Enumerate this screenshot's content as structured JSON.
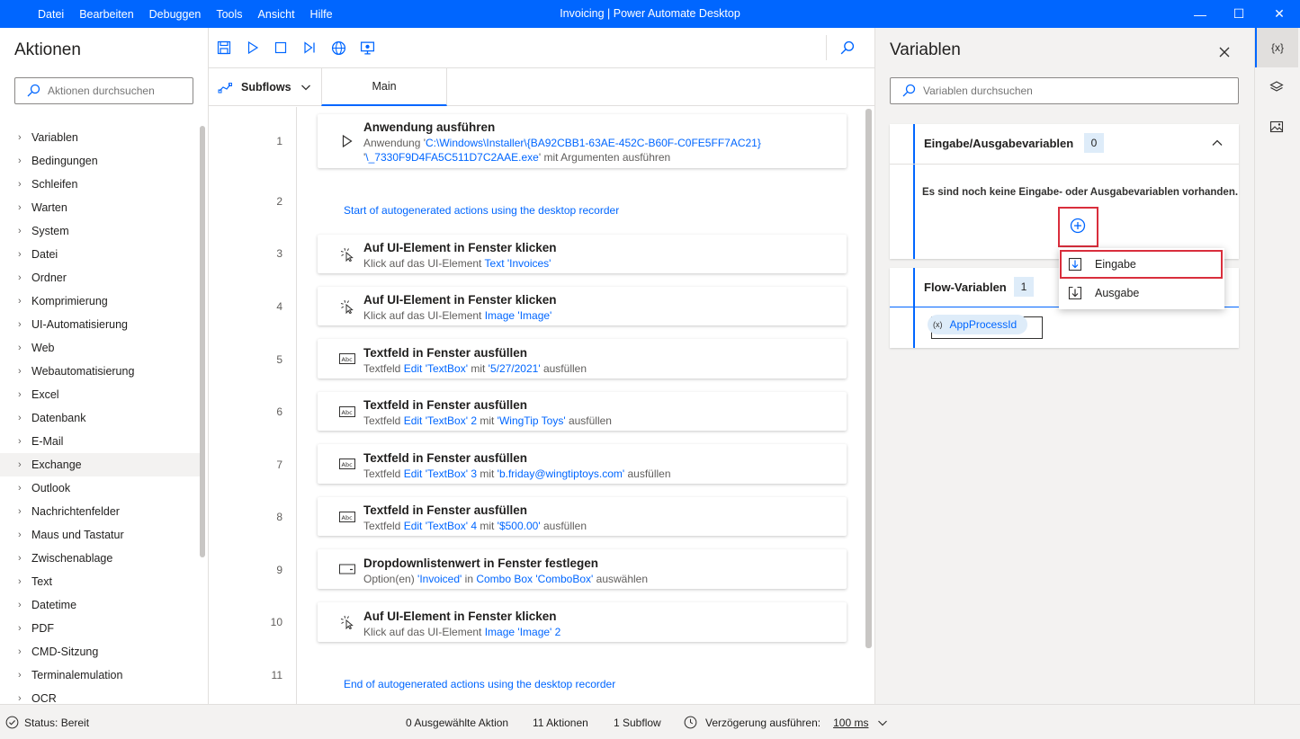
{
  "window": {
    "title": "Invoicing | Power Automate Desktop",
    "menu": [
      "Datei",
      "Bearbeiten",
      "Debuggen",
      "Tools",
      "Ansicht",
      "Hilfe"
    ],
    "minimize": "—",
    "maximize": "☐",
    "close": "✕"
  },
  "actions_panel": {
    "title": "Aktionen",
    "search_placeholder": "Aktionen durchsuchen",
    "categories": [
      "Variablen",
      "Bedingungen",
      "Schleifen",
      "Warten",
      "System",
      "Datei",
      "Ordner",
      "Komprimierung",
      "UI-Automatisierung",
      "Web",
      "Webautomatisierung",
      "Excel",
      "Datenbank",
      "E-Mail",
      "Exchange",
      "Outlook",
      "Nachrichtenfelder",
      "Maus und Tastatur",
      "Zwischenablage",
      "Text",
      "Datetime",
      "PDF",
      "CMD-Sitzung",
      "Terminalemulation",
      "OCR"
    ],
    "selected_category": "Exchange"
  },
  "editor": {
    "subflows_label": "Subflows",
    "main_tab": "Main",
    "line_numbers": [
      "1",
      "2",
      "3",
      "4",
      "5",
      "6",
      "7",
      "8",
      "9",
      "10",
      "11"
    ],
    "comment_start": "Start of autogenerated actions using the desktop recorder",
    "comment_end": "End of autogenerated actions using the desktop recorder",
    "steps": [
      {
        "title": "Anwendung ausführen",
        "d0": "Anwendung '",
        "l0": "C:\\Windows\\Installer\\{BA92CBB1-63AE-452C-B60F-C0FE5FF7AC21}",
        "d1": "'",
        "l1": "\\_7330F9D4FA5C511D7C2AAE.exe",
        "d2": "' mit Argumenten ausführen"
      },
      {
        "title": "Auf UI-Element in Fenster klicken",
        "d0": "Klick auf das UI-Element ",
        "l0": "Text 'Invoices'"
      },
      {
        "title": "Auf UI-Element in Fenster klicken",
        "d0": "Klick auf das UI-Element ",
        "l0": "Image 'Image'"
      },
      {
        "title": "Textfeld in Fenster ausfüllen",
        "d0": "Textfeld ",
        "l0": "Edit 'TextBox'",
        "d1": " mit ",
        "l1": "'5/27/2021'",
        "d2": " ausfüllen"
      },
      {
        "title": "Textfeld in Fenster ausfüllen",
        "d0": "Textfeld ",
        "l0": "Edit 'TextBox' 2",
        "d1": " mit ",
        "l1": "'WingTip Toys'",
        "d2": " ausfüllen"
      },
      {
        "title": "Textfeld in Fenster ausfüllen",
        "d0": "Textfeld ",
        "l0": "Edit 'TextBox' 3",
        "d1": " mit ",
        "l1": "'b.friday@wingtiptoys.com'",
        "d2": " ausfüllen"
      },
      {
        "title": "Textfeld in Fenster ausfüllen",
        "d0": "Textfeld ",
        "l0": "Edit 'TextBox' 4",
        "d1": " mit ",
        "l1": "'$500.00'",
        "d2": " ausfüllen"
      },
      {
        "title": "Dropdownlistenwert in Fenster festlegen",
        "d0": "Option(en) ",
        "l0": "'Invoiced'",
        "d1": " in ",
        "l1": "Combo Box 'ComboBox'",
        "d2": " auswählen"
      },
      {
        "title": "Auf UI-Element in Fenster klicken",
        "d0": "Klick auf das UI-Element ",
        "l0": "Image 'Image' 2"
      }
    ]
  },
  "variables_panel": {
    "title": "Variablen",
    "search_placeholder": "Variablen durchsuchen",
    "io_section": {
      "title": "Eingabe/Ausgabevariablen",
      "count": "0",
      "empty_text": "Es sind noch keine Eingabe- oder Ausgabevariablen vorhanden."
    },
    "flow_section": {
      "title": "Flow-Variablen",
      "count": "1",
      "chip_prefix": "(x)",
      "variables": [
        "AppProcessId"
      ]
    },
    "add_menu": [
      "Eingabe",
      "Ausgabe"
    ]
  },
  "right_rail": {
    "variables_icon_label": "{x}"
  },
  "status_bar": {
    "status": "Status: Bereit",
    "selected": "0 Ausgewählte Aktion",
    "actions": "11 Aktionen",
    "subflows": "1 Subflow",
    "delay_label": "Verzögerung ausführen:",
    "delay_value": "100 ms"
  },
  "colors": {
    "accent": "#0066ff",
    "highlight": "#d92e3c",
    "panel": "#f3f2f1"
  }
}
